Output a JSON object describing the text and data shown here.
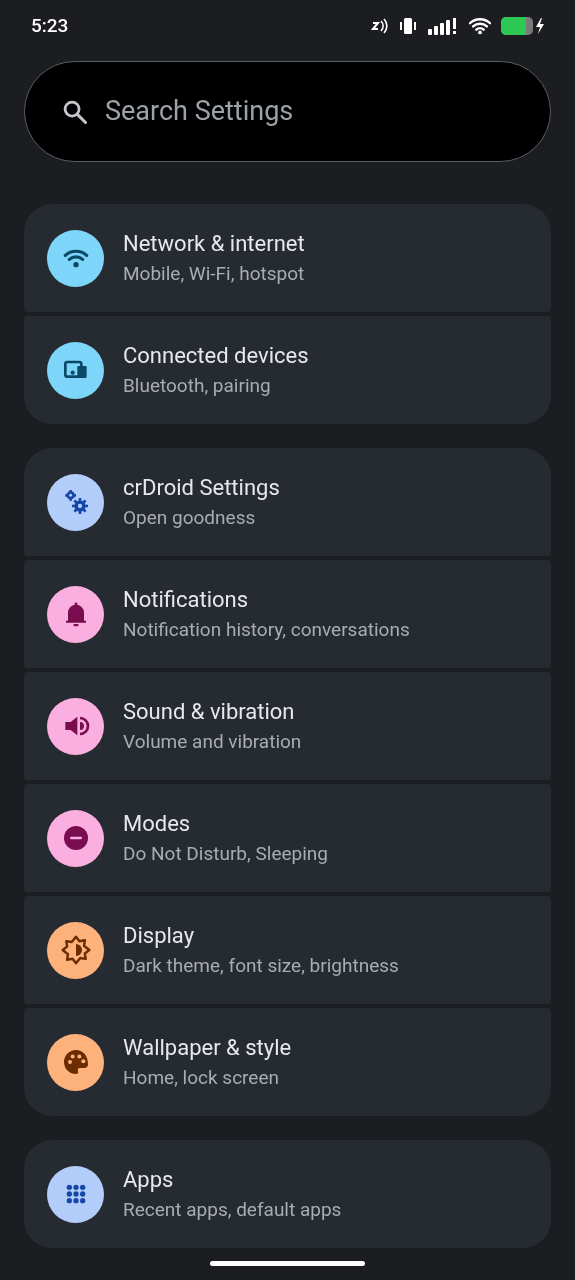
{
  "status_bar": {
    "time": "5:23"
  },
  "search": {
    "placeholder": "Search Settings"
  },
  "groups": [
    {
      "items": [
        {
          "title": "Network & internet",
          "subtitle": "Mobile, Wi-Fi, hotspot",
          "color": "#7dd6f9"
        },
        {
          "title": "Connected devices",
          "subtitle": "Bluetooth, pairing",
          "color": "#7dd6f9"
        }
      ]
    },
    {
      "items": [
        {
          "title": "crDroid Settings",
          "subtitle": "Open goodness",
          "color": "#b3cdfb"
        },
        {
          "title": "Notifications",
          "subtitle": "Notification history, conversations",
          "color": "#fbaee0"
        },
        {
          "title": "Sound & vibration",
          "subtitle": "Volume and vibration",
          "color": "#fbaee0"
        },
        {
          "title": "Modes",
          "subtitle": "Do Not Disturb, Sleeping",
          "color": "#fbaee0"
        },
        {
          "title": "Display",
          "subtitle": "Dark theme, font size, brightness",
          "color": "#fdb27c"
        },
        {
          "title": "Wallpaper & style",
          "subtitle": "Home, lock screen",
          "color": "#fdb27c"
        }
      ]
    },
    {
      "items": [
        {
          "title": "Apps",
          "subtitle": "Recent apps, default apps",
          "color": "#b3cdfb"
        }
      ]
    }
  ]
}
